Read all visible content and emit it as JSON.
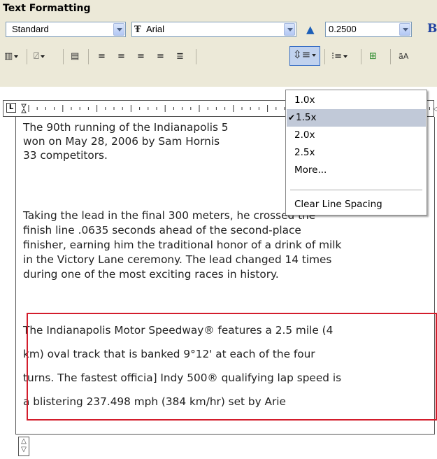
{
  "title": "Text Formatting",
  "style_select": {
    "value": "Standard"
  },
  "font_select": {
    "value": "Arial",
    "font_icon": "truetype-font-icon"
  },
  "height_select": {
    "value": "0.2500"
  },
  "bold_label": "B",
  "menu": {
    "items": [
      {
        "label": "1.0x",
        "checked": false
      },
      {
        "label": "1.5x",
        "checked": true
      },
      {
        "label": "2.0x",
        "checked": false
      },
      {
        "label": "2.5x",
        "checked": false
      },
      {
        "label": "More...",
        "checked": false
      }
    ],
    "clear_label": "Clear Line Spacing"
  },
  "editor": {
    "tab_marker": "L",
    "paragraph1": [
      "The 90th running of the Indianapolis 5",
      "won on May 28, 2006 by Sam Hornis",
      "33 competitors."
    ],
    "paragraph2": [
      "Taking the lead in the final 300 meters, he crossed the",
      "finish line .0635 seconds ahead of the second-place",
      "finisher, earning him the traditional honor of a drink of milk",
      "in the Victory Lane ceremony. The lead changed 14 times",
      "during one of the most exciting races in history."
    ],
    "paragraph3": [
      "The Indianapolis Motor Speedway® features a 2.5 mile (4",
      "km) oval track that is banked 9°12' at each of the four",
      "turns. The fastest officia] Indy 500® qualifying lap speed is",
      "a blistering 237.498 mph (384 km/hr) set by Arie"
    ]
  },
  "colors": {
    "accent": "#316ac5",
    "highlight_box": "#d31d2c",
    "panel": "#ece9d8"
  }
}
